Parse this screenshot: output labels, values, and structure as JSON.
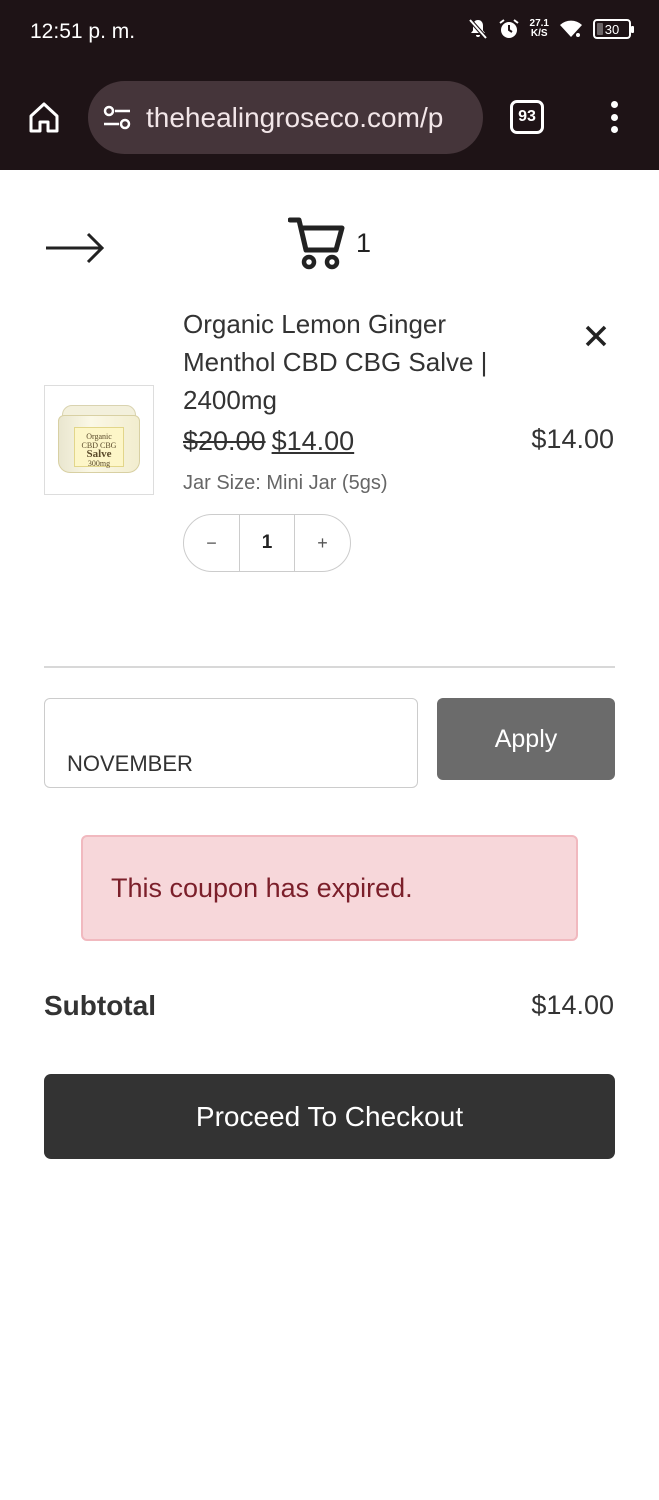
{
  "status_bar": {
    "time": "12:51 p. m.",
    "net_speed_value": "27.1",
    "net_speed_unit": "K/S",
    "battery": "30",
    "battery_level": 0.3
  },
  "browser": {
    "url": "thehealingroseco.com/p",
    "tab_count": "93",
    "icons": [
      "home-icon",
      "site-settings-icon",
      "tabs-icon",
      "more-menu-icon"
    ]
  },
  "cart": {
    "count": "1",
    "icons": [
      "arrow-right-icon",
      "cart-icon",
      "close-icon"
    ]
  },
  "item": {
    "title": "Organic Lemon Ginger Menthol CBD CBG Salve | 2400mg",
    "price_original": "$20.00",
    "price_sale": "$14.00",
    "line_total": "$14.00",
    "variant": "Jar Size: Mini Jar (5gs)",
    "quantity": "1",
    "qty_minus": "−",
    "qty_plus": "+",
    "image_label": {
      "line1": "Organic",
      "line2": "CBD CBG",
      "line3": "Salve",
      "line4": "300mg"
    }
  },
  "coupon": {
    "value": "NOVEMBER",
    "apply_label": "Apply",
    "error": "This coupon has expired."
  },
  "summary": {
    "subtotal_label": "Subtotal",
    "subtotal_value": "$14.00"
  },
  "checkout": {
    "label": "Proceed To Checkout"
  }
}
